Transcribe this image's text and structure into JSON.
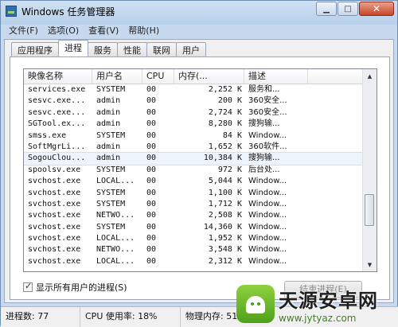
{
  "window": {
    "title": "Windows 任务管理器"
  },
  "title_controls": [
    "minimize",
    "maximize",
    "close"
  ],
  "menu": [
    "文件(F)",
    "选项(O)",
    "查看(V)",
    "帮助(H)"
  ],
  "tabs": [
    {
      "label": "应用程序",
      "active": false
    },
    {
      "label": "进程",
      "active": true
    },
    {
      "label": "服务",
      "active": false
    },
    {
      "label": "性能",
      "active": false
    },
    {
      "label": "联网",
      "active": false
    },
    {
      "label": "用户",
      "active": false
    }
  ],
  "processes": {
    "columns": [
      "映像名称",
      "用户名",
      "CPU",
      "内存(...",
      "描述"
    ],
    "selected_index": 6,
    "rows": [
      [
        "services.exe",
        "SYSTEM",
        "00",
        "2,252 K",
        "服务和..."
      ],
      [
        "sesvc.exe...",
        "admin",
        "00",
        "200 K",
        "360安全..."
      ],
      [
        "sesvc.exe...",
        "admin",
        "00",
        "2,724 K",
        "360安全..."
      ],
      [
        "SGTool.ex...",
        "admin",
        "00",
        "8,280 K",
        "搜狗输..."
      ],
      [
        "smss.exe",
        "SYSTEM",
        "00",
        "84 K",
        "Window..."
      ],
      [
        "SoftMgrLi...",
        "admin",
        "00",
        "1,652 K",
        "360软件..."
      ],
      [
        "SogouClou...",
        "admin",
        "00",
        "10,384 K",
        "搜狗输..."
      ],
      [
        "spoolsv.exe",
        "SYSTEM",
        "00",
        "972 K",
        "后台处..."
      ],
      [
        "svchost.exe",
        "LOCAL...",
        "00",
        "5,044 K",
        "Window..."
      ],
      [
        "svchost.exe",
        "SYSTEM",
        "00",
        "1,100 K",
        "Window..."
      ],
      [
        "svchost.exe",
        "SYSTEM",
        "00",
        "1,712 K",
        "Window..."
      ],
      [
        "svchost.exe",
        "NETWO...",
        "00",
        "2,508 K",
        "Window..."
      ],
      [
        "svchost.exe",
        "SYSTEM",
        "00",
        "14,360 K",
        "Window..."
      ],
      [
        "svchost.exe",
        "LOCAL...",
        "00",
        "1,952 K",
        "Window..."
      ],
      [
        "svchost.exe",
        "NETWO...",
        "00",
        "3,548 K",
        "Window..."
      ],
      [
        "svchost.exe",
        "LOCAL...",
        "00",
        "2,312 K",
        "Window..."
      ]
    ],
    "scroll_position": 0.78
  },
  "show_all_users": {
    "label": "显示所有用户的进程(S)",
    "checked": true
  },
  "end_process_button": {
    "label": "结束进程(E)"
  },
  "status": {
    "processes": "进程数: 77",
    "cpu": "CPU 使用率: 18%",
    "memory": "物理内存: 51"
  },
  "watermark": {
    "title": "天源安卓网",
    "url": "www.jytyaz.com"
  }
}
